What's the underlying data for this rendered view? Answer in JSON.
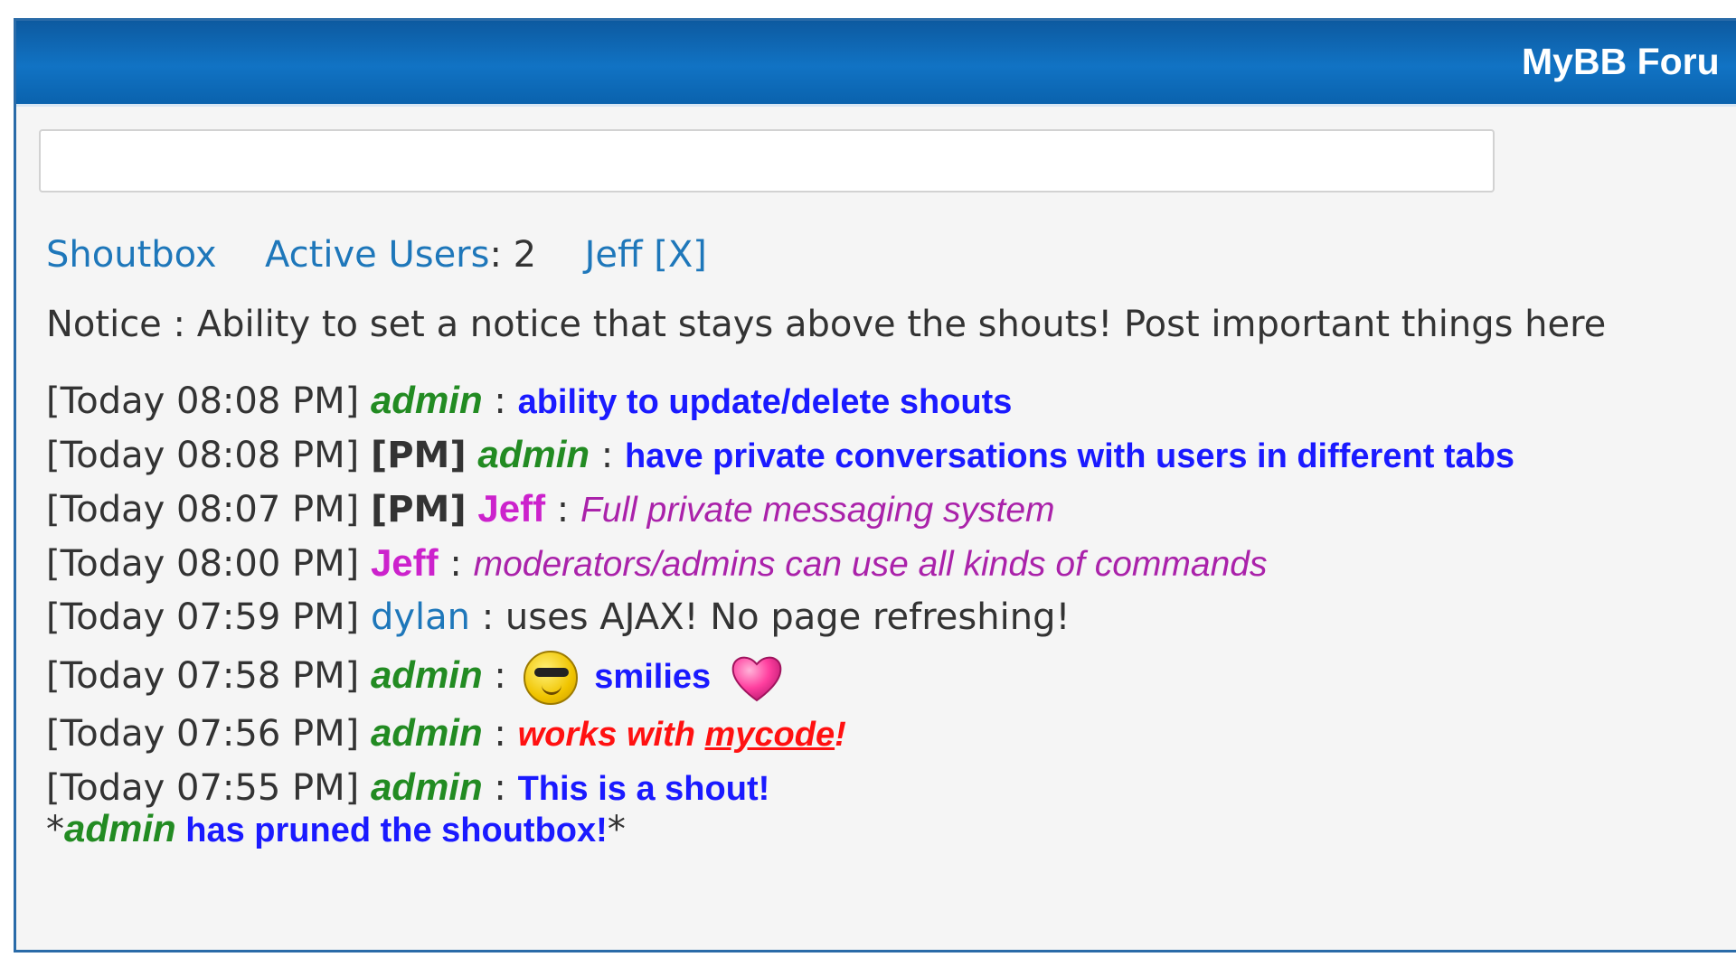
{
  "header": {
    "title": "MyBB Foru"
  },
  "input": {
    "value": "",
    "placeholder": ""
  },
  "tabs": {
    "shoutbox": "Shoutbox",
    "active_users_label": "Active Users",
    "active_users_colon": ":",
    "active_users_count": "2",
    "chat_tab_user": "Jeff",
    "close": "[X]"
  },
  "notice": "Notice : Ability to set a notice that stays above the shouts! Post important things here",
  "shouts": [
    {
      "time": "[Today 08:08 PM]",
      "pm": "",
      "user": "admin",
      "sep": ":",
      "text": "ability to update/delete shouts"
    },
    {
      "time": "[Today 08:08 PM]",
      "pm": "[PM]",
      "user": "admin",
      "sep": ":",
      "text": "have private conversations with users in different tabs"
    },
    {
      "time": "[Today 08:07 PM]",
      "pm": "[PM]",
      "user": "Jeff",
      "sep": ":",
      "text": "Full private messaging system"
    },
    {
      "time": "[Today 08:00 PM]",
      "pm": "",
      "user": "Jeff",
      "sep": ":",
      "text": "moderators/admins can use all kinds of commands"
    },
    {
      "time": "[Today 07:59 PM]",
      "pm": "",
      "user": "dylan",
      "sep": ":",
      "text": "uses AJAX! No page refreshing!"
    },
    {
      "time": "[Today 07:58 PM]",
      "pm": "",
      "user": "admin",
      "sep": ":",
      "text": "smilies",
      "icons": [
        "cool-smiley-icon",
        "heart-icon"
      ]
    },
    {
      "time": "[Today 07:56 PM]",
      "pm": "",
      "user": "admin",
      "sep": ":",
      "text_before": "works with ",
      "link": "mycode",
      "text_after": "!"
    },
    {
      "time": "[Today 07:55 PM]",
      "pm": "",
      "user": "admin",
      "sep": ":",
      "text": "This is a shout!"
    }
  ],
  "prune": {
    "star_open": "*",
    "user": "admin",
    "text": " has pruned the shoutbox!",
    "star_close": "*"
  },
  "colors": {
    "header": "#0d5aa0",
    "admin": "#228b22",
    "jeff": "#cc22cc",
    "link": "#1e77ba",
    "blue_text": "#1a1aff",
    "red_text": "#ff1111"
  }
}
